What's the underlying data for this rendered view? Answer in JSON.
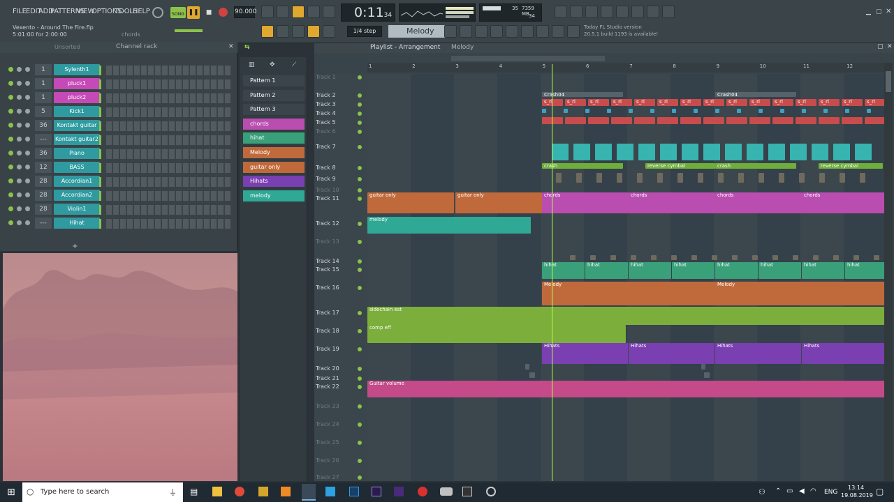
{
  "menu": [
    "FILE",
    "EDIT",
    "ADD",
    "PATTERNS",
    "VIEW",
    "OPTIONS",
    "TOOLS",
    "HELP"
  ],
  "project": {
    "file": "Vexento - Around The Fire.flp",
    "time_info": "5:01:00 for 2:00:00",
    "hint": "chords"
  },
  "transport": {
    "tempo": "90.000",
    "time": "0:11",
    "time_small": "34",
    "song_label": "SONG",
    "pattern_label": "Melody",
    "snap": "1/4 step",
    "memory": "7359 MB",
    "cpu": "35",
    "poly": "34"
  },
  "news": {
    "line1": "Today  FL Studio version",
    "line2": "20.5.1 build 1193 is available!"
  },
  "channelrack": {
    "title": "Channel rack",
    "filter": "Unsorted",
    "channels": [
      {
        "num": "1",
        "name": "Sylenth1",
        "color": "#2f9aa0"
      },
      {
        "num": "1",
        "name": "pluck1",
        "color": "#c54ab7"
      },
      {
        "num": "1",
        "name": "pluck2",
        "color": "#c54ab7"
      },
      {
        "num": "5",
        "name": "Kick1",
        "color": "#2f9aa0"
      },
      {
        "num": "36",
        "name": "Kontakt guitar",
        "color": "#2f9aa0"
      },
      {
        "num": "---",
        "name": "Kontakt guitar2",
        "color": "#2f9aa0"
      },
      {
        "num": "36",
        "name": "Piano",
        "color": "#2f9aa0"
      },
      {
        "num": "12",
        "name": "BASS",
        "color": "#2f9aa0"
      },
      {
        "num": "28",
        "name": "Accordian1",
        "color": "#2f9aa0"
      },
      {
        "num": "28",
        "name": "Accordian2",
        "color": "#2f9aa0"
      },
      {
        "num": "28",
        "name": "Violin1",
        "color": "#2f9aa0"
      },
      {
        "num": "---",
        "name": "Hihat",
        "color": "#2f9aa0"
      }
    ]
  },
  "patterns": [
    {
      "name": "Pattern 1",
      "color": "#3a444a"
    },
    {
      "name": "Pattern 2",
      "color": "#3a444a"
    },
    {
      "name": "Pattern 3",
      "color": "#3a444a"
    },
    {
      "name": "chords",
      "color": "#b94db0"
    },
    {
      "name": "hihat",
      "color": "#3aa07a"
    },
    {
      "name": "Melody",
      "color": "#c06a3c"
    },
    {
      "name": "guitar only",
      "color": "#c06a3c"
    },
    {
      "name": "Hihats",
      "color": "#7a3fb0"
    },
    {
      "name": "melody",
      "color": "#2fa895"
    }
  ],
  "playlist": {
    "title": "Playlist - Arrangement",
    "pattern": "Melody",
    "bars": [
      "1",
      "2",
      "3",
      "4",
      "5",
      "6",
      "7",
      "8",
      "9",
      "10",
      "11",
      "12"
    ]
  },
  "tracks": [
    "Track 1",
    "Track 2",
    "Track 3",
    "Track 4",
    "Track 5",
    "Track 6",
    "Track 7",
    "Track 8",
    "Track 9",
    "Track 10",
    "Track 11",
    "Track 12",
    "Track 13",
    "Track 14",
    "Track 15",
    "Track 16",
    "Track 17",
    "Track 18",
    "Track 19",
    "Track 20",
    "Track 21",
    "Track 22",
    "Track 23",
    "Track 24",
    "Track 25",
    "Track 26",
    "Track 27"
  ],
  "clips": {
    "crash04": "Crash04",
    "crash": "crash",
    "reverse": "reverse cymbal",
    "guitar_only": "guitar only",
    "chords": "chords",
    "melody": "melody",
    "hihat": "hihat",
    "Melody": "Melody",
    "sidechain": "sidechain est",
    "comp": "comp eff",
    "hihats": "Hihats",
    "guitar_volume": "Guitar volume",
    "s_rl": "s_rl"
  },
  "taskbar": {
    "search": "Type here to search",
    "lang": "ENG",
    "time": "13:14",
    "date": "19.08.2019"
  }
}
